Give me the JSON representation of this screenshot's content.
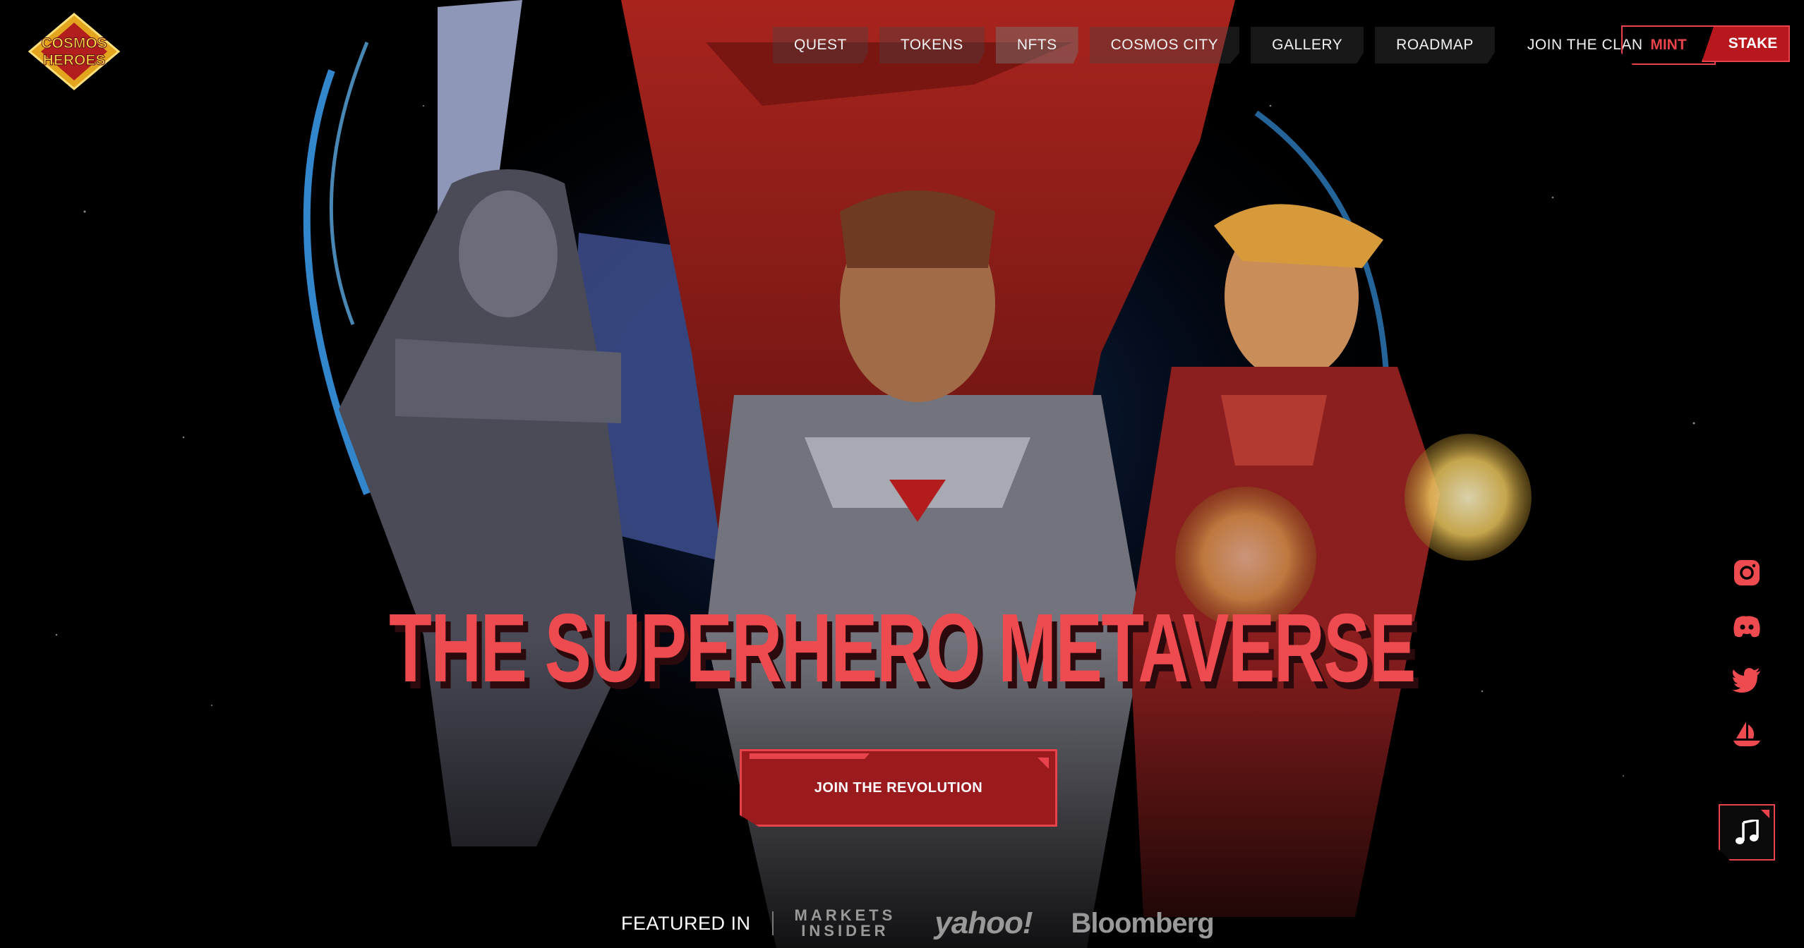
{
  "brand": {
    "logo_line1": "COSMOS",
    "logo_line2": "HEROES"
  },
  "nav": {
    "items": [
      {
        "label": "QUEST"
      },
      {
        "label": "TOKENS"
      },
      {
        "label": "NFTS"
      },
      {
        "label": "COSMOS CITY"
      },
      {
        "label": "GALLERY"
      },
      {
        "label": "ROADMAP"
      },
      {
        "label": "JOIN THE CLAN"
      }
    ],
    "mint_label": "MINT",
    "stake_label": "STAKE"
  },
  "hero": {
    "headline": "THE SUPERHERO METAVERSE",
    "cta_label": "JOIN THE REVOLUTION"
  },
  "featured": {
    "label": "FEATURED IN",
    "markets_line1": "MARKETS",
    "markets_line2": "INSIDER",
    "yahoo": "yahoo!",
    "bloomberg": "Bloomberg"
  },
  "social": [
    "instagram-icon",
    "discord-icon",
    "twitter-icon",
    "opensea-icon"
  ],
  "colors": {
    "accent": "#ee4b50",
    "accent_dark": "#9b1a1e",
    "background": "#000000"
  }
}
